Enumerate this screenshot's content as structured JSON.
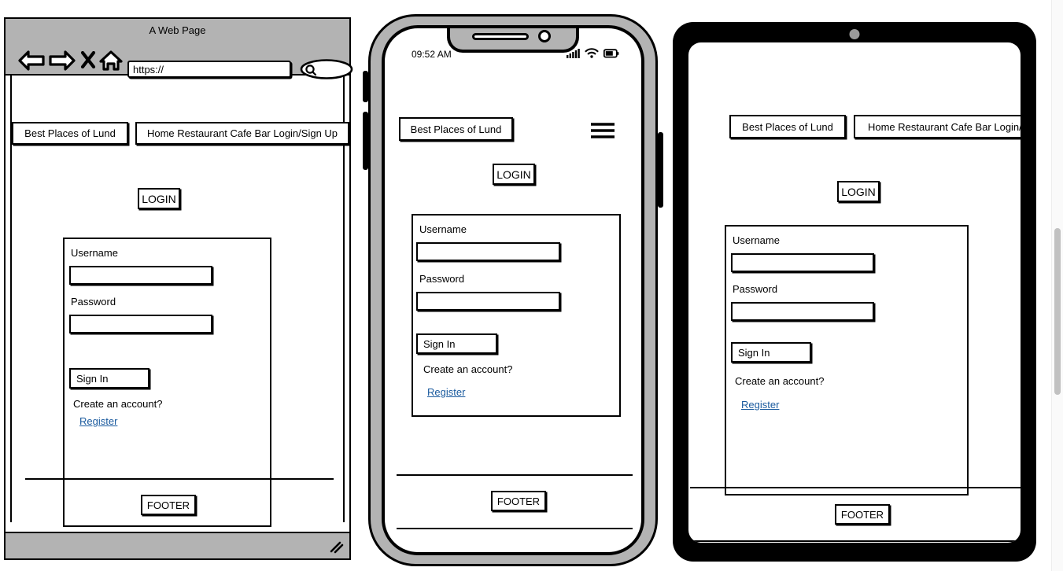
{
  "browser": {
    "title": "A Web Page",
    "url_value": "https://",
    "icons": {
      "back": "back-arrow-icon",
      "forward": "forward-arrow-icon",
      "stop": "close-x-icon",
      "home": "home-icon",
      "search": "search-icon",
      "resize": "resize-grip-icon"
    }
  },
  "phone": {
    "time": "09:52 AM",
    "icons": {
      "signal": "cellular-signal-icon",
      "wifi": "wifi-icon",
      "battery": "battery-icon",
      "menu": "hamburger-menu-icon",
      "speaker": "earpiece-speaker-icon",
      "camera": "front-camera-icon"
    }
  },
  "tablet": {
    "icons": {
      "camera": "front-camera-icon"
    }
  },
  "site": {
    "brand_button": "Best Places of Lund",
    "nav_button": "Home Restaurant Cafe Bar Login/Sign Up",
    "page_heading": "LOGIN",
    "form": {
      "username_label": "Username",
      "username_value": "",
      "password_label": "Password",
      "password_value": "",
      "submit_label": "Sign In",
      "create_account_text": "Create an account?",
      "register_link": "Register"
    },
    "footer_label": "FOOTER"
  },
  "colors": {
    "chrome_gray": "#b3b3b3",
    "stroke_black": "#000000",
    "link_blue": "#1a5a9e",
    "tablet_bezel": "#000000",
    "camera_gray": "#9a9a9a"
  }
}
